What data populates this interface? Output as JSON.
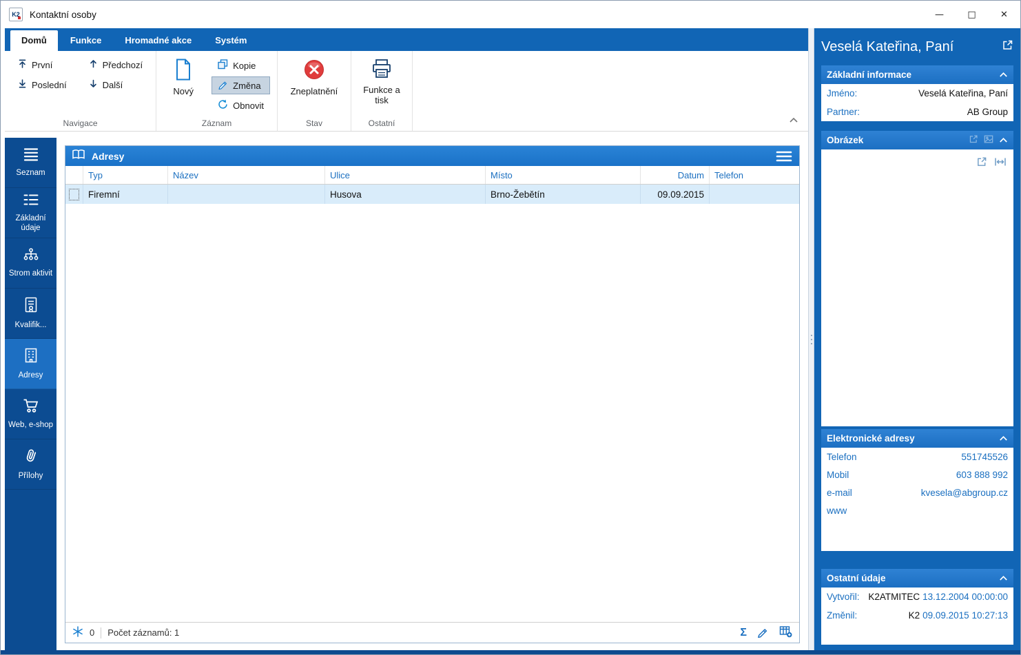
{
  "window": {
    "title": "Kontaktní osoby",
    "logo": "K2",
    "controls": {
      "minimize": "—",
      "maximize": "□",
      "close": "✕"
    }
  },
  "colors": {
    "ribbon_blue": "#1165b5",
    "sidebar_blue": "#0c4c92",
    "accent_blue": "#1a6fc0",
    "selected_row_blue": "#d9ecfa",
    "invalid_red": "#e03c3c"
  },
  "ribbon": {
    "tabs": [
      {
        "label": "Domů",
        "active": true
      },
      {
        "label": "Funkce",
        "active": false
      },
      {
        "label": "Hromadné akce",
        "active": false
      },
      {
        "label": "Systém",
        "active": false
      }
    ],
    "navigace": {
      "label": "Navigace",
      "first": "První",
      "previous": "Předchozí",
      "last": "Poslední",
      "next": "Další"
    },
    "zaznam": {
      "label": "Záznam",
      "new": "Nový",
      "copy": "Kopie",
      "change": "Změna",
      "refresh": "Obnovit"
    },
    "stav": {
      "label": "Stav",
      "invalidate": "Zneplatnění"
    },
    "ostatni": {
      "label": "Ostatní",
      "functions_print": "Funkce a tisk"
    }
  },
  "sidebar": {
    "items": [
      {
        "label": "Seznam",
        "icon": "menu-icon",
        "active": false
      },
      {
        "label": "Základní údaje",
        "icon": "list-icon",
        "active": false
      },
      {
        "label": "Strom aktivit",
        "icon": "tree-icon",
        "active": false
      },
      {
        "label": "Kvalifik...",
        "icon": "certificate-icon",
        "active": false
      },
      {
        "label": "Adresy",
        "icon": "building-icon",
        "active": true
      },
      {
        "label": "Web, e-shop",
        "icon": "cart-icon",
        "active": false
      },
      {
        "label": "Přílohy",
        "icon": "paperclip-icon",
        "active": false
      }
    ]
  },
  "main": {
    "panel_title": "Adresy",
    "table": {
      "columns": [
        {
          "label": "Typ"
        },
        {
          "label": "Název"
        },
        {
          "label": "Ulice"
        },
        {
          "label": "Místo"
        },
        {
          "label": "Datum"
        },
        {
          "label": "Telefon"
        }
      ],
      "rows": [
        {
          "typ": "Firemní",
          "nazev": "",
          "ulice": "Husova",
          "misto": "Brno-Žebětín",
          "datum": "09.09.2015",
          "telefon": ""
        }
      ]
    },
    "statusbar": {
      "flag_count": "0",
      "record_count": "Počet záznamů: 1",
      "sigma": "Σ"
    }
  },
  "details": {
    "title": "Veselá Kateřina, Paní",
    "basic": {
      "title": "Základní informace",
      "rows": [
        {
          "label": "Jméno:",
          "value": "Veselá Kateřina, Paní"
        },
        {
          "label": "Partner:",
          "value": "AB Group"
        }
      ]
    },
    "picture": {
      "title": "Obrázek"
    },
    "electronic": {
      "title": "Elektronické adresy",
      "rows": [
        {
          "label": "Telefon",
          "value": "551745526"
        },
        {
          "label": "Mobil",
          "value": "603 888 992"
        },
        {
          "label": "e-mail",
          "value": "kvesela@abgroup.cz"
        },
        {
          "label": "www",
          "value": ""
        }
      ]
    },
    "other": {
      "title": "Ostatní údaje",
      "rows": [
        {
          "label": "Vytvořil:",
          "user": "K2ATMITEC",
          "date": "13.12.2004 00:00:00"
        },
        {
          "label": "Změnil:",
          "user": "K2",
          "date": "09.09.2015 10:27:13"
        }
      ]
    }
  }
}
